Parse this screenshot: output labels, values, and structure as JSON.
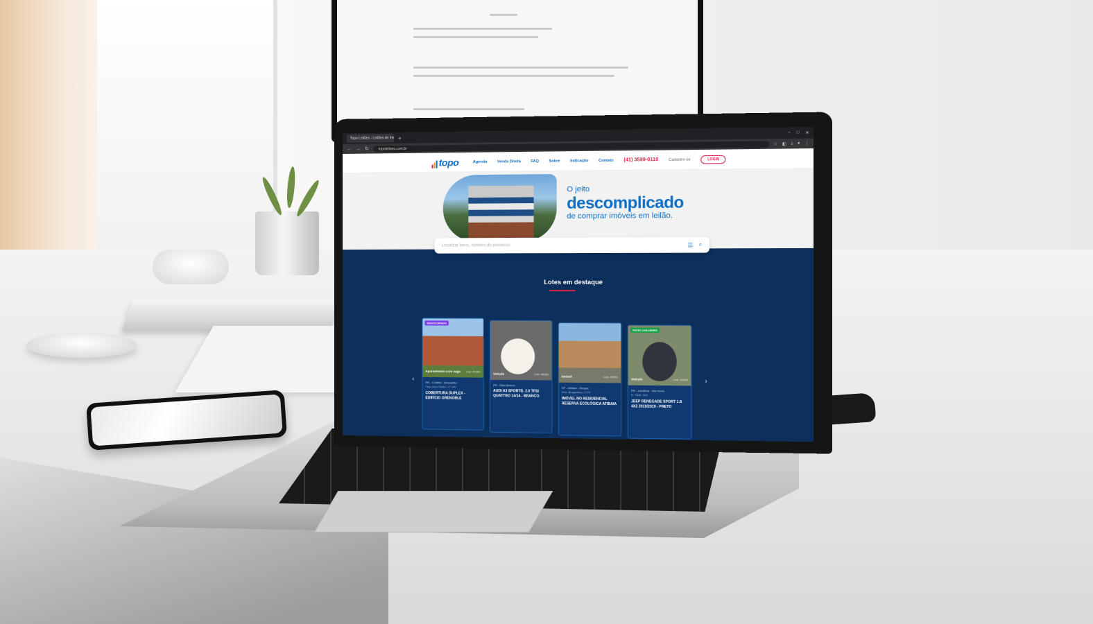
{
  "browser": {
    "tab_title": "Topo Leilões - Leilões de Imóv…",
    "url": "topoleiloes.com.br"
  },
  "header": {
    "logo_text": "topo",
    "nav": [
      "Agenda",
      "Venda Direta",
      "FAQ",
      "Sobre",
      "Indicação",
      "Contato"
    ],
    "phone": "(41) 3599-0110",
    "signup_label": "Cadastre-se",
    "login_label": "LOGIN"
  },
  "hero": {
    "line1": "O jeito",
    "line2": "descomplicado",
    "line3": "de comprar imóveis em leilão."
  },
  "search": {
    "placeholder": "Localizar bens, número do processo"
  },
  "featured": {
    "title": "Lotes em destaque",
    "cards": [
      {
        "badge": "DESOCUPADO",
        "badge_color": "#7c3aed",
        "category": "Apartamento com vaga",
        "code": "Cód. #1090",
        "location": "PR - Curitiba - Boqueirão",
        "extra": "Trav. Bom Retiro, nº 100",
        "name": "COBERTURA DUPLEX - EDIFÍCIO GRENOBLE",
        "img": "building"
      },
      {
        "badge": "",
        "badge_color": "",
        "category": "Veículo",
        "code": "Cód. #9363",
        "location": "PR - Pato Branco",
        "extra": "",
        "name": "AUDI A3 SPORTB. 2.0 TFSI QUATTRO 14/14 - BRANCO",
        "img": "car-white"
      },
      {
        "badge": "",
        "badge_color": "",
        "category": "Imóvel",
        "code": "Cód. #1051",
        "location": "SP - Atibaia - Tanque",
        "extra": "Estr. Bragantina, 7770",
        "name": "IMÓVEL NO RESIDENCIAL RESERVA ECOLÓGICA ATIBAIA",
        "img": "house"
      },
      {
        "badge": "PATIO LEILOEIRO",
        "badge_color": "#16a34a",
        "category": "Veículo",
        "code": "Cód. #9061",
        "location": "PR - Londrina - Vila Nova",
        "extra": "R. Tietê, 900",
        "name": "JEEP RENEGADE SPORT 1.8 4X2 2019/2019 - PRETO",
        "img": "car-dark"
      }
    ]
  },
  "colors": {
    "brand_blue": "#0d6fc6",
    "accent_red": "#e11d48",
    "navy": "#0c2f5c"
  }
}
